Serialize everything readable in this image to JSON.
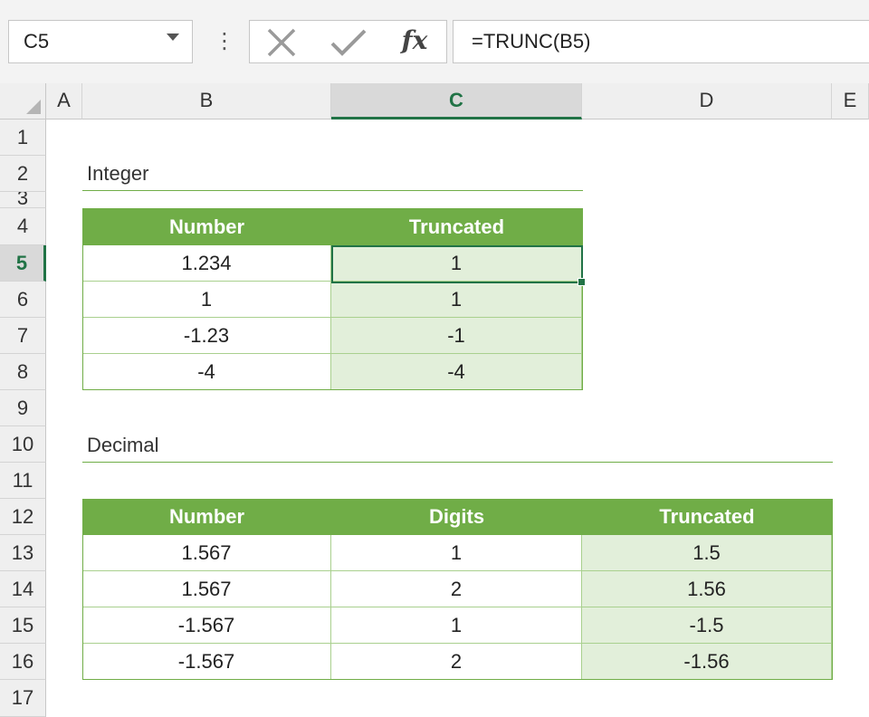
{
  "name_box": "C5",
  "formula": "=TRUNC(B5)",
  "fx_label": "fx",
  "icons": {
    "cancel": "x-icon",
    "enter": "check-icon",
    "insert_function": "fx-icon"
  },
  "columns": [
    "A",
    "B",
    "C",
    "D",
    "E"
  ],
  "rows": [
    "1",
    "2",
    "3",
    "4",
    "5",
    "6",
    "7",
    "8",
    "9",
    "10",
    "11",
    "12",
    "13",
    "14",
    "15",
    "16",
    "17"
  ],
  "selected": {
    "column": "C",
    "row": "5"
  },
  "integer": {
    "title": "Integer",
    "headers": [
      "Number",
      "Truncated"
    ],
    "rows": [
      [
        "1.234",
        "1"
      ],
      [
        "1",
        "1"
      ],
      [
        "-1.23",
        "-1"
      ],
      [
        "-4",
        "-4"
      ]
    ]
  },
  "decimal": {
    "title": "Decimal",
    "headers": [
      "Number",
      "Digits",
      "Truncated"
    ],
    "rows": [
      [
        "1.567",
        "1",
        "1.5"
      ],
      [
        "1.567",
        "2",
        "1.56"
      ],
      [
        "-1.567",
        "1",
        "-1.5"
      ],
      [
        "-1.567",
        "2",
        "-1.56"
      ]
    ]
  },
  "colors": {
    "header_green": "#70ad47",
    "result_fill": "#e2efda",
    "selection": "#217346"
  }
}
